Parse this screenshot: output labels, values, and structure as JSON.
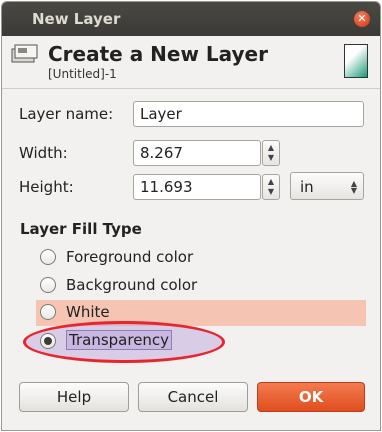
{
  "window": {
    "title": "New Layer",
    "close_symbol": "✕"
  },
  "header": {
    "title": "Create a New Layer",
    "subtitle": "[Untitled]-1"
  },
  "fields": {
    "layer_name": {
      "label": "Layer name:",
      "value": "Layer"
    },
    "width": {
      "label": "Width:",
      "value": "8.267"
    },
    "height": {
      "label": "Height:",
      "value": "11.693"
    },
    "unit": {
      "value": "in"
    }
  },
  "fill_type": {
    "title": "Layer Fill Type",
    "options": [
      {
        "label": "Foreground color",
        "selected": false
      },
      {
        "label": "Background color",
        "selected": false
      },
      {
        "label": "White",
        "selected": false
      },
      {
        "label": "Transparency",
        "selected": true
      }
    ]
  },
  "buttons": {
    "help": "Help",
    "cancel": "Cancel",
    "ok": "OK"
  },
  "colors": {
    "titlebar": "#3c3b37",
    "ok_button": "#e45a2a",
    "highlight_ellipse": "#e8242c",
    "white_row": "#f5c4b3"
  },
  "icons": {
    "layer": "layer-icon",
    "close": "close-icon",
    "thumbnail": "layer-thumbnail"
  }
}
